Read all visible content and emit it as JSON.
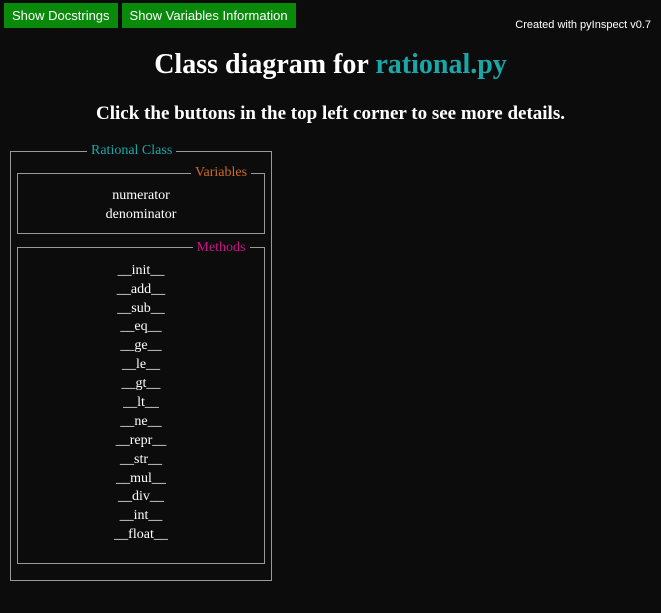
{
  "buttons": {
    "docstrings": "Show Docstrings",
    "variables": "Show Variables Information"
  },
  "credit": "Created with pyInspect v0.7",
  "title_prefix": "Class diagram for ",
  "title_filename": "rational.py",
  "subtitle": "Click the buttons in the top left corner to see more details.",
  "class": {
    "name": "Rational Class",
    "vars_legend": "Variables",
    "methods_legend": "Methods",
    "variables": [
      "numerator",
      "denominator"
    ],
    "methods": [
      "__init__",
      "__add__",
      "__sub__",
      "__eq__",
      "__ge__",
      "__le__",
      "__gt__",
      "__lt__",
      "__ne__",
      "__repr__",
      "__str__",
      "__mul__",
      "__div__",
      "__int__",
      "__float__"
    ]
  }
}
